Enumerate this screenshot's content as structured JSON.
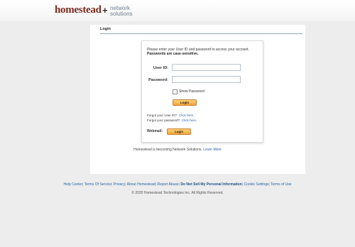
{
  "header": {
    "brand_homestead": "homestead",
    "brand_plus": "+",
    "brand_ns_line1": "network",
    "brand_ns_line2": "solutions"
  },
  "login_panel": {
    "title": "Login",
    "intro_line1": "Please enter your User ID and password to access your account.",
    "intro_line2": "Passwords are case-sensitive.",
    "userid_label": "User ID:",
    "userid_value": "",
    "password_label": "Password:",
    "password_value": "",
    "show_password_label": "Show Password",
    "login_button": "Login",
    "forgot_userid_text": "Forgot your User ID?",
    "forgot_userid_link": "Click here.",
    "forgot_password_text": "Forgot your password?",
    "forgot_password_link": "Click here.",
    "webmail_label": "Webmail:",
    "webmail_button": "Login"
  },
  "notice": {
    "text": "Homestead is becoming Network Solutions.",
    "link": "Learn More"
  },
  "footer": {
    "links": [
      "Help Center",
      "Terms Of Service",
      "Privacy",
      "About Homestead",
      "Report Abuse",
      "Do Not Sell My Personal Information",
      "Cookie Settings",
      "Terms of Use"
    ],
    "copyright": "© 2020 Homestead Technologies Inc. All Rights Reserved."
  },
  "colors": {
    "brand": "#7a2a1e",
    "link": "#2a64a8",
    "button": "#f0a43a"
  }
}
